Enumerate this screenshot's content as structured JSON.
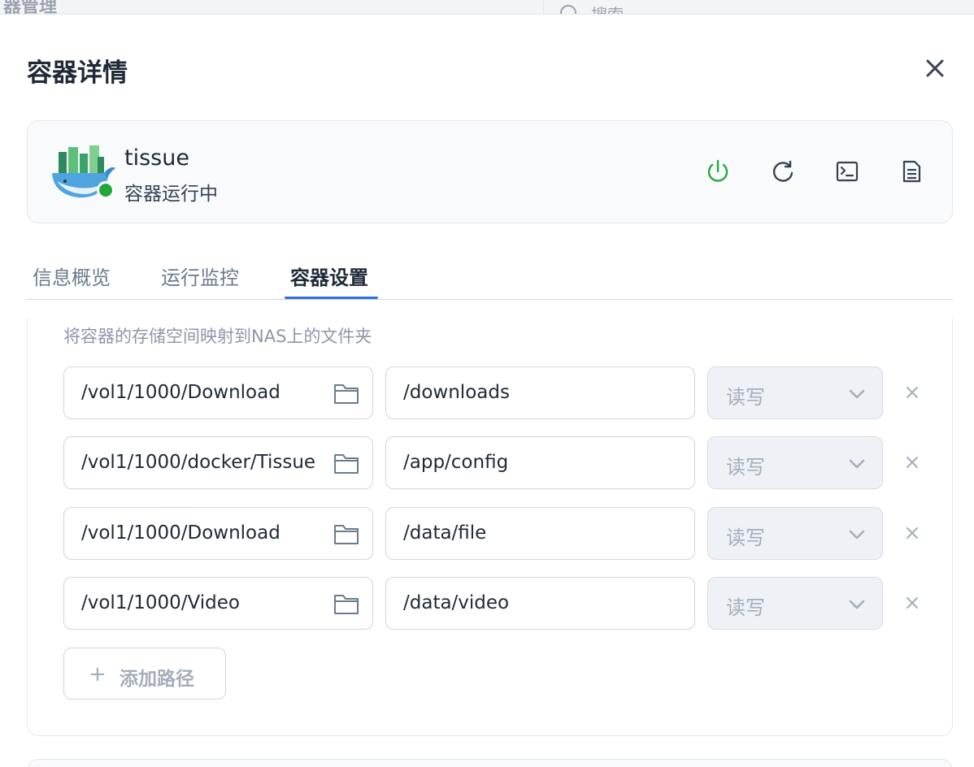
{
  "background": {
    "title": "器管理",
    "search_placeholder": "搜索"
  },
  "modal": {
    "title": "容器详情"
  },
  "container": {
    "name": "tissue",
    "status": "容器运行中",
    "status_color": "#22a83a",
    "actions": [
      {
        "name": "power",
        "icon": "power-icon",
        "color": "#22a83a"
      },
      {
        "name": "restart",
        "icon": "restart-icon",
        "color": "#374151"
      },
      {
        "name": "terminal",
        "icon": "terminal-icon",
        "color": "#374151"
      },
      {
        "name": "logs",
        "icon": "document-icon",
        "color": "#374151"
      }
    ]
  },
  "tabs": [
    {
      "label": "信息概览",
      "active": false
    },
    {
      "label": "运行监控",
      "active": false
    },
    {
      "label": "容器设置",
      "active": true
    }
  ],
  "storage": {
    "hint": "将容器的存储空间映射到NAS上的文件夹",
    "mappings": [
      {
        "host_path": "/vol1/1000/Download",
        "container_path": "/downloads",
        "permission": "读写"
      },
      {
        "host_path": "/vol1/1000/docker/Tissue",
        "container_path": "/app/config",
        "permission": "读写"
      },
      {
        "host_path": "/vol1/1000/Download",
        "container_path": "/data/file",
        "permission": "读写"
      },
      {
        "host_path": "/vol1/1000/Video",
        "container_path": "/data/video",
        "permission": "读写"
      }
    ],
    "add_label": "添加路径",
    "add_icon": "+"
  },
  "accent_color": "#2f6fe0"
}
